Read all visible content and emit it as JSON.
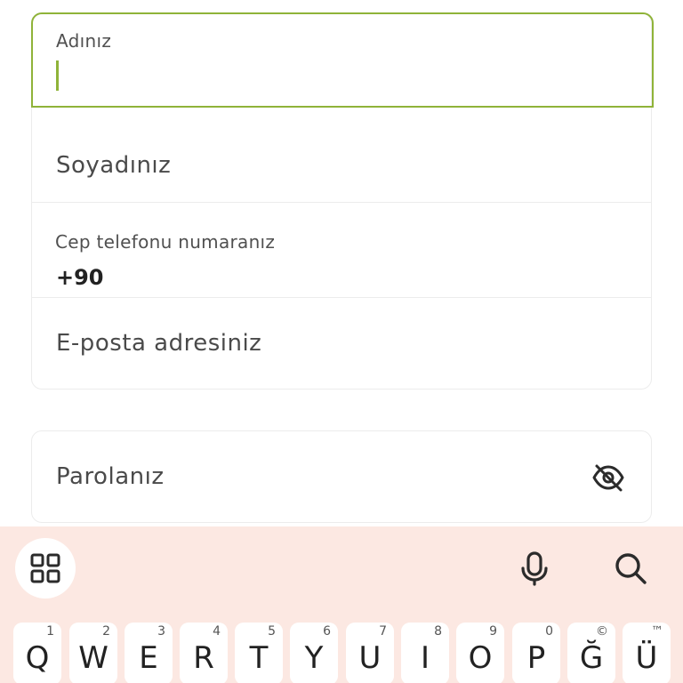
{
  "form": {
    "first_name": {
      "label": "Adınız",
      "value": ""
    },
    "last_name": {
      "label": "Soyadınız"
    },
    "phone": {
      "label": "Cep telefonu numaranız",
      "value": "+90"
    },
    "email": {
      "label": "E-posta adresiniz"
    },
    "password": {
      "label": "Parolanız",
      "toggle_icon": "eye-off-icon"
    }
  },
  "colors": {
    "focus_accent": "#8fb339",
    "keyboard_background": "#fce8e2",
    "key_background": "#ffffff"
  },
  "keyboard": {
    "toolbar": {
      "apps_icon": "grid-icon",
      "mic_icon": "microphone-icon",
      "search_icon": "search-icon"
    },
    "row1": [
      {
        "char": "Q",
        "hint": "1"
      },
      {
        "char": "W",
        "hint": "2"
      },
      {
        "char": "E",
        "hint": "3"
      },
      {
        "char": "R",
        "hint": "4"
      },
      {
        "char": "T",
        "hint": "5"
      },
      {
        "char": "Y",
        "hint": "6"
      },
      {
        "char": "U",
        "hint": "7"
      },
      {
        "char": "I",
        "hint": "8"
      },
      {
        "char": "O",
        "hint": "9"
      },
      {
        "char": "P",
        "hint": "0"
      },
      {
        "char": "Ğ",
        "hint": "©"
      },
      {
        "char": "Ü",
        "hint": "™"
      }
    ]
  }
}
